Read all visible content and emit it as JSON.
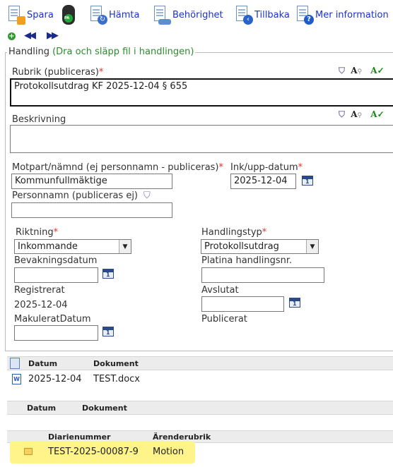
{
  "toolbar": {
    "save_label": "Spara",
    "fetch_label": "Hämta",
    "permission_label": "Behörighet",
    "back_label": "Tillbaka",
    "more_info_label": "Mer information",
    "pa_text": "PA"
  },
  "section": {
    "legend_prefix": "Handling",
    "legend_hint": "(Dra och släpp fil i handlingen)"
  },
  "fields": {
    "rubrik_label": "Rubrik (publiceras)",
    "rubrik_value": "Protokollsutdrag KF 2025-12-04 § 655",
    "beskrivning_label": "Beskrivning",
    "beskrivning_value": "",
    "motpart_label": "Motpart/nämnd (ej personnamn - publiceras)",
    "motpart_value": "Kommunfullmäktige",
    "inkupp_label": "Ink/upp-datum",
    "inkupp_value": "2025-12-04",
    "personnamn_label": "Personnamn (publiceras ej)",
    "personnamn_value": "",
    "riktning_label": "Riktning",
    "riktning_value": "Inkommande",
    "handlingstyp_label": "Handlingstyp",
    "handlingstyp_value": "Protokollsutdrag",
    "bevakning_label": "Bevakningsdatum",
    "bevakning_value": "",
    "platina_label": "Platina handlingsnr.",
    "platina_value": "",
    "registrerat_label": "Registrerat",
    "registrerat_value": "2025-12-04",
    "avslutat_label": "Avslutat",
    "avslutat_value": "",
    "makulerat_label": "MakuleratDatum",
    "makulerat_value": "",
    "publicerat_label": "Publicerat",
    "required_mark": "*"
  },
  "spell_tools": {
    "font_glyph": "A",
    "check_glyph": "A✓"
  },
  "files_table": {
    "headers": [
      "Datum",
      "Dokument"
    ],
    "rows": [
      {
        "date": "2025-12-04",
        "document": "TEST.docx"
      }
    ]
  },
  "docs_table": {
    "headers": [
      "Datum",
      "Dokument"
    ]
  },
  "cases_table": {
    "headers": [
      "Diarienummer",
      "Ärenderubrik"
    ],
    "rows": [
      {
        "number": "TEST-2025-00087-9",
        "title": "Motion"
      }
    ]
  },
  "colors": {
    "link_blue": "#1a33cc",
    "legend_green": "#2e8b2e",
    "required_red": "#e0302a",
    "highlight_yellow": "#fff48a"
  }
}
